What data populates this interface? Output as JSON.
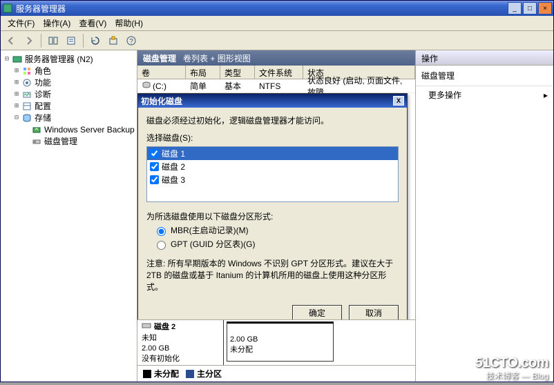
{
  "window": {
    "title": "服务器管理器"
  },
  "menu": {
    "file": "文件(F)",
    "action": "操作(A)",
    "view": "查看(V)",
    "help": "帮助(H)"
  },
  "tree": {
    "root": "服务器管理器 (N2)",
    "roles": "角色",
    "features": "功能",
    "diagnostics": "诊断",
    "config": "配置",
    "storage": "存储",
    "wsb": "Windows Server Backup",
    "diskmgmt": "磁盘管理"
  },
  "center": {
    "title": "磁盘管理",
    "subtitle": "卷列表 + 图形视图",
    "cols": {
      "vol": "卷",
      "layout": "布局",
      "type": "类型",
      "fs": "文件系统",
      "status": "状态"
    },
    "row0": {
      "vol": "(C:)",
      "layout": "简单",
      "type": "基本",
      "fs": "NTFS",
      "status": "状态良好 (启动, 页面文件, 故障"
    }
  },
  "dialog": {
    "title": "初始化磁盘",
    "msg": "磁盘必须经过初始化，逻辑磁盘管理器才能访问。",
    "select": "选择磁盘(S):",
    "d1": "磁盘 1",
    "d2": "磁盘 2",
    "d3": "磁盘 3",
    "styleprompt": "为所选磁盘使用以下磁盘分区形式:",
    "mbr": "MBR(主启动记录)(M)",
    "gpt": "GPT (GUID 分区表)(G)",
    "note": "注意: 所有早期版本的 Windows 不识别 GPT 分区形式。建议在大于 2TB 的磁盘或基于 Itanium 的计算机所用的磁盘上使用这种分区形式。",
    "ok": "确定",
    "cancel": "取消"
  },
  "diskpanel": {
    "name": "磁盘 2",
    "state": "未知",
    "size": "2.00 GB",
    "init": "没有初始化",
    "seg_size": "2.00 GB",
    "seg_state": "未分配",
    "legend_unalloc": "未分配",
    "legend_primary": "主分区"
  },
  "actions": {
    "header": "操作",
    "section": "磁盘管理",
    "more": "更多操作"
  },
  "watermark": {
    "l1": "51CTO.com",
    "l2": "技术博客 — Blog"
  }
}
